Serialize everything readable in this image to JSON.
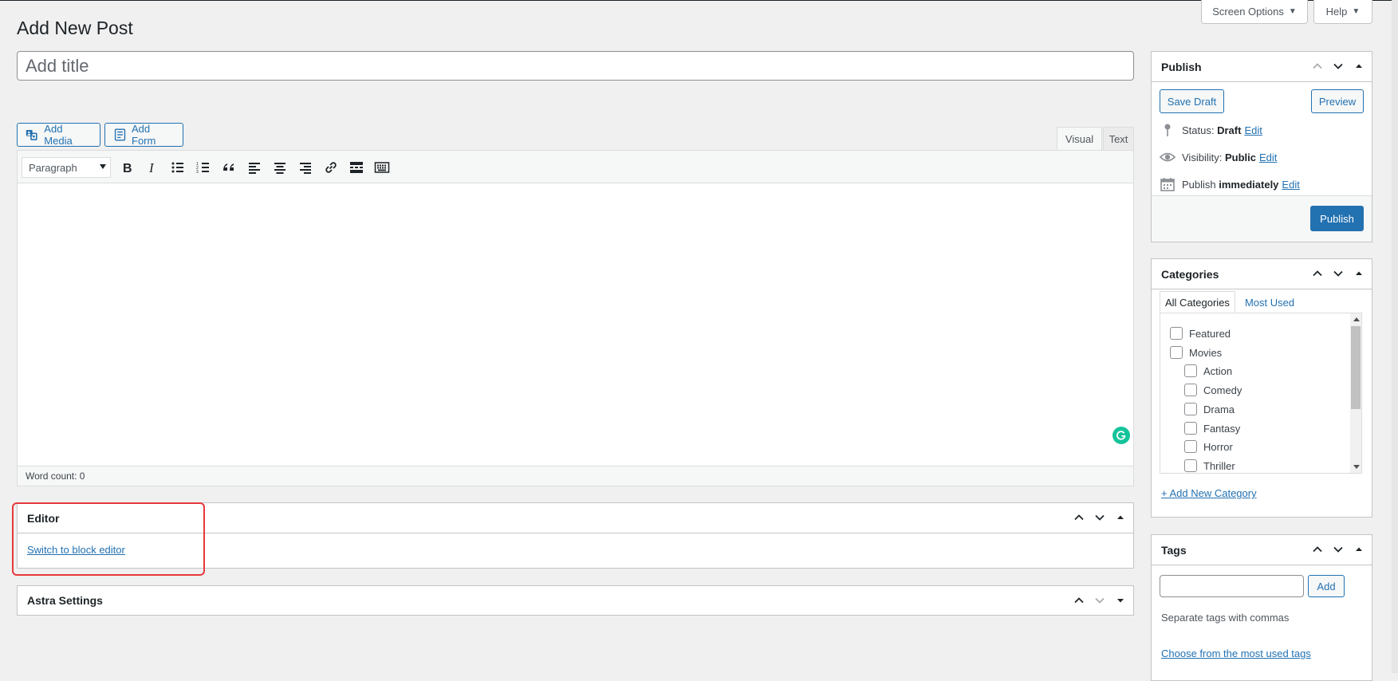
{
  "screen_meta": {
    "screen_options": "Screen Options",
    "help": "Help"
  },
  "page_title": "Add New Post",
  "title_field": {
    "placeholder": "Add title",
    "value": ""
  },
  "media_buttons": {
    "add_media": "Add Media",
    "add_form": "Add Form"
  },
  "editor_tabs": {
    "visual": "Visual",
    "text": "Text",
    "active": "Visual"
  },
  "toolbar": {
    "format_select": "Paragraph",
    "buttons": [
      "bold-icon",
      "italic-icon",
      "bulleted-list-icon",
      "numbered-list-icon",
      "blockquote-icon",
      "align-left-icon",
      "align-center-icon",
      "align-right-icon",
      "link-icon",
      "read-more-icon",
      "toolbar-toggle-icon"
    ]
  },
  "editor_status": {
    "word_count": "Word count: 0"
  },
  "editor_box": {
    "title": "Editor",
    "switch_link": "Switch to block editor"
  },
  "astra_box": {
    "title": "Astra Settings"
  },
  "publish_box": {
    "title": "Publish",
    "save_draft": "Save Draft",
    "preview": "Preview",
    "status_label": "Status:",
    "status_value": "Draft",
    "visibility_label": "Visibility:",
    "visibility_value": "Public",
    "publish_label": "Publish",
    "publish_value": "immediately",
    "edit": "Edit",
    "publish_button": "Publish"
  },
  "categories_box": {
    "title": "Categories",
    "tab_all": "All Categories",
    "tab_most_used": "Most Used",
    "items": [
      {
        "label": "Featured",
        "level": 0,
        "checked": false
      },
      {
        "label": "Movies",
        "level": 0,
        "checked": false
      },
      {
        "label": "Action",
        "level": 1,
        "checked": false
      },
      {
        "label": "Comedy",
        "level": 1,
        "checked": false
      },
      {
        "label": "Drama",
        "level": 1,
        "checked": false
      },
      {
        "label": "Fantasy",
        "level": 1,
        "checked": false
      },
      {
        "label": "Horror",
        "level": 1,
        "checked": false
      },
      {
        "label": "Thriller",
        "level": 1,
        "checked": false
      }
    ],
    "add_new": "+ Add New Category"
  },
  "tags_box": {
    "title": "Tags",
    "input_value": "",
    "add_button": "Add",
    "hint": "Separate tags with commas",
    "choose_link": "Choose from the most used tags"
  },
  "colors": {
    "accent": "#2271b1",
    "highlight": "#e8383b",
    "grammarly": "#15c39a"
  }
}
